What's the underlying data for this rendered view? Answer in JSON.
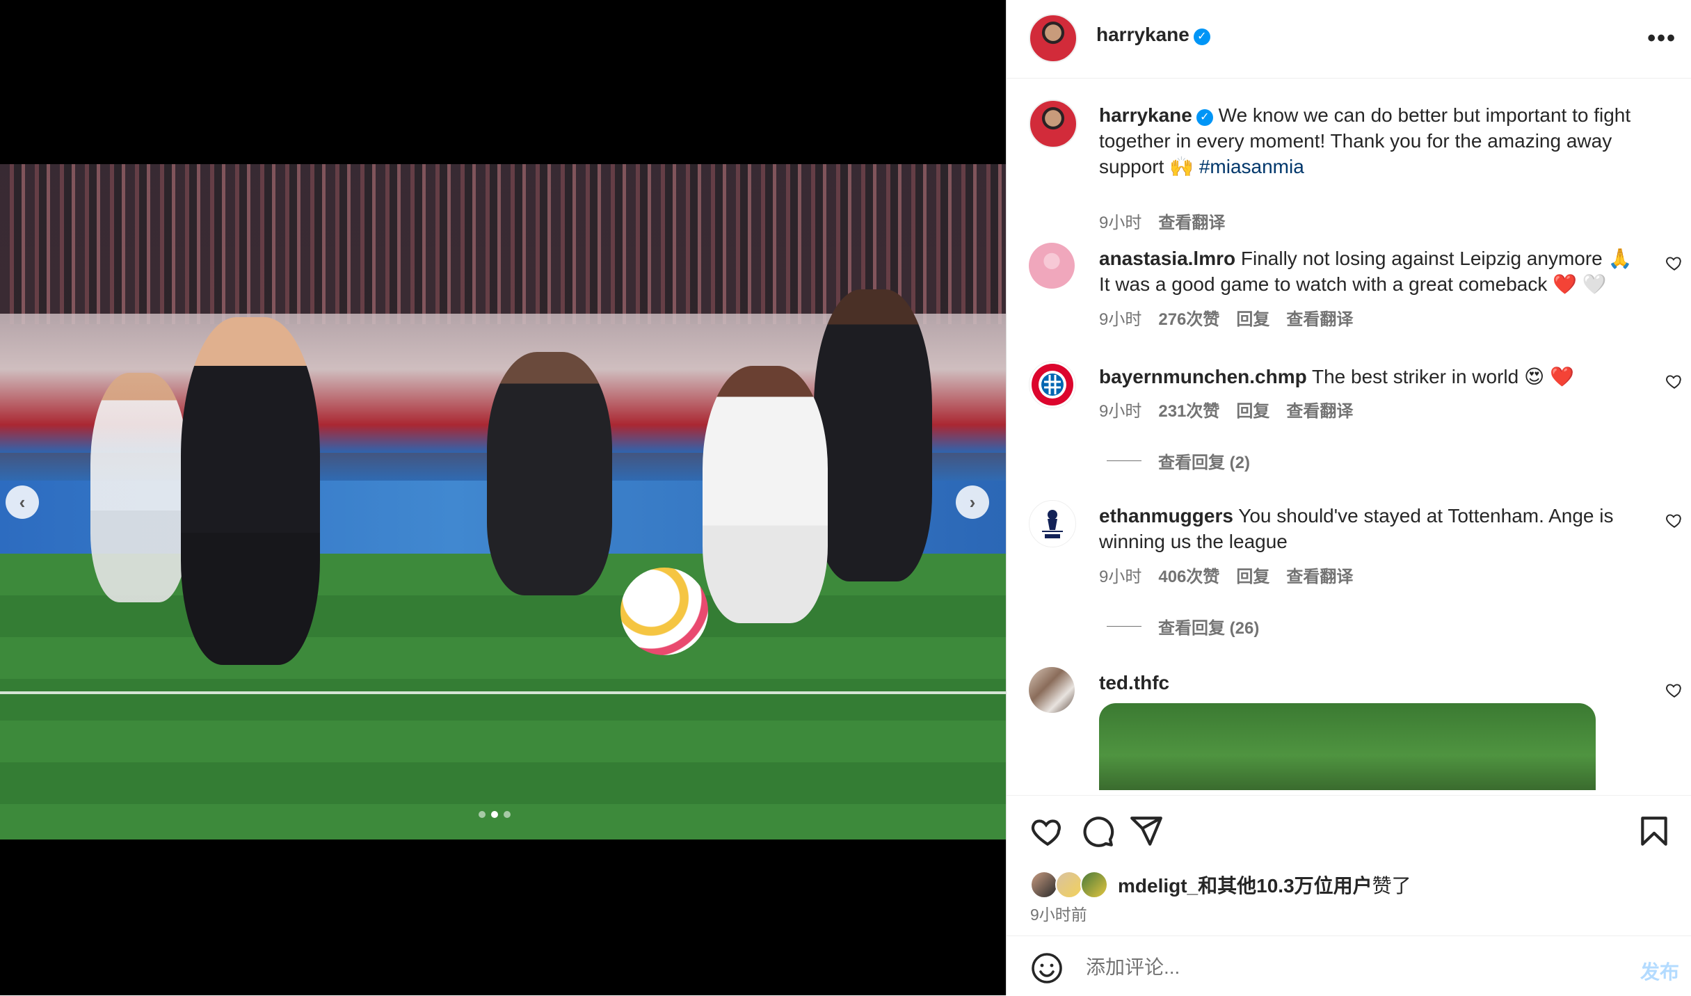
{
  "carousel": {
    "prev_icon": "chevron-left-icon",
    "next_icon": "chevron-right-icon",
    "prev_glyph": "‹",
    "next_glyph": "›",
    "total_slides": 3,
    "active_slide": 2
  },
  "header": {
    "username": "harrykane",
    "verified": true,
    "more_glyph": "•••"
  },
  "caption": {
    "username": "harrykane",
    "text": " We know we can do better but important to fight together in every moment! Thank you for the amazing away support 🙌 ",
    "hashtag": "#miasanmia",
    "time": "9小时",
    "translate": "查看翻译"
  },
  "comments": [
    {
      "username": "anastasia.lmro",
      "text": " Finally not losing against Leipzig anymore 🙏 It was a good game to watch with a great comeback ❤️ 🤍",
      "time": "9小时",
      "likes": "276次赞",
      "reply": "回复",
      "translate": "查看翻译"
    },
    {
      "username": "bayernmunchen.chmp",
      "text": " The best striker in world 😍 ❤️",
      "time": "9小时",
      "likes": "231次赞",
      "reply": "回复",
      "translate": "查看翻译",
      "view_replies": "查看回复 (2)"
    },
    {
      "username": "ethanmuggers",
      "text": " You should've stayed at Tottenham. Ange is winning us the league",
      "time": "9小时",
      "likes": "406次赞",
      "reply": "回复",
      "translate": "查看翻译",
      "view_replies": "查看回复 (26)"
    },
    {
      "username": "ted.thfc"
    }
  ],
  "likes": {
    "first_user": "mdeligt_",
    "connector": "和",
    "others": "其他10.3万位用户",
    "suffix": "赞了"
  },
  "post_time": "9小时前",
  "comment_box": {
    "placeholder": "添加评论...",
    "post_label": "发布"
  },
  "colors": {
    "accent_blue": "#0095f6",
    "hashtag": "#00376b",
    "secondary_text": "#737373",
    "post_button_disabled": "#b3dbff"
  }
}
